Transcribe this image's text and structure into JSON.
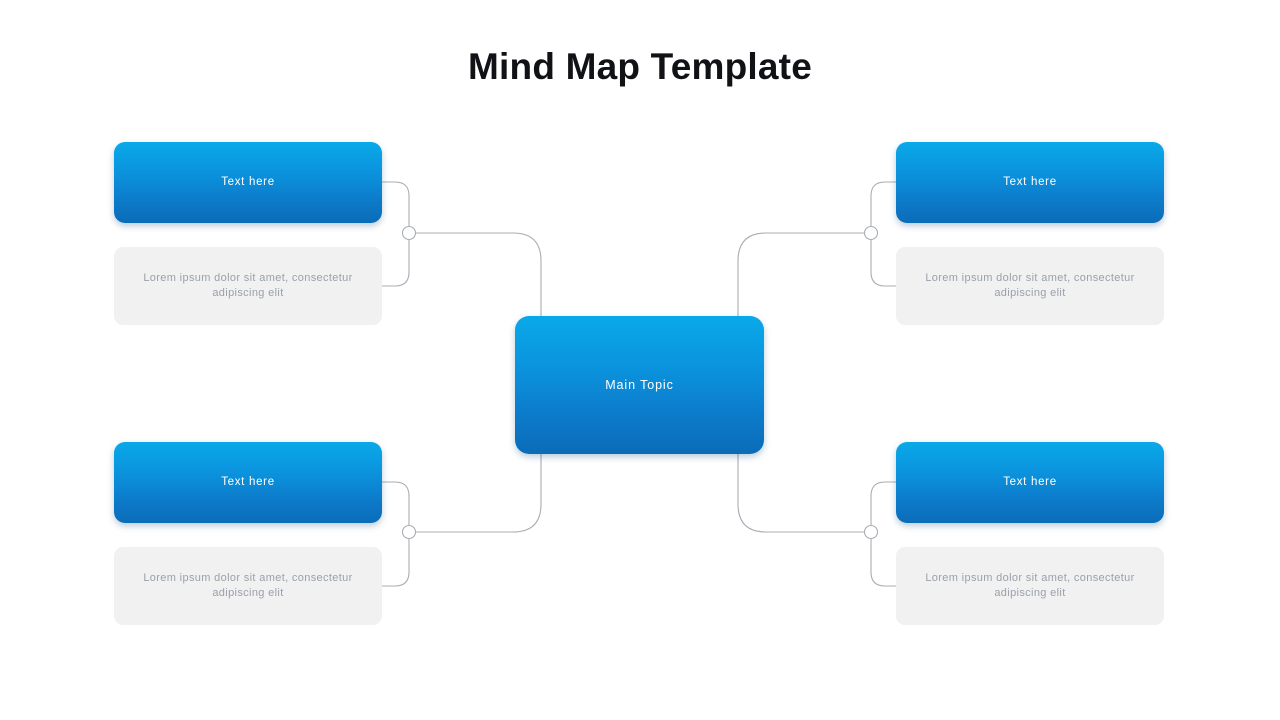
{
  "page": {
    "title": "Mind Map Template",
    "background_color": "#ffffff"
  },
  "theme": {
    "accent_gradient_top": "#09a9e9",
    "accent_gradient_bottom": "#0b6cb8",
    "topic_text_color": "#ffffff",
    "desc_background": "#f1f1f1",
    "desc_text_color": "#9aa0ab",
    "connector_color": "#a9acb3",
    "title_color": "#111216"
  },
  "center": {
    "label": "Main Topic"
  },
  "branches": [
    {
      "id": "top-left",
      "topic_label": "Text here",
      "description": "Lorem ipsum dolor sit amet, consectetur adipiscing elit"
    },
    {
      "id": "bottom-left",
      "topic_label": "Text here",
      "description": "Lorem ipsum dolor sit amet, consectetur adipiscing elit"
    },
    {
      "id": "top-right",
      "topic_label": "Text here",
      "description": "Lorem ipsum dolor sit amet, consectetur adipiscing elit"
    },
    {
      "id": "bottom-right",
      "topic_label": "Text here",
      "description": "Lorem ipsum dolor sit amet, consectetur adipiscing elit"
    }
  ]
}
